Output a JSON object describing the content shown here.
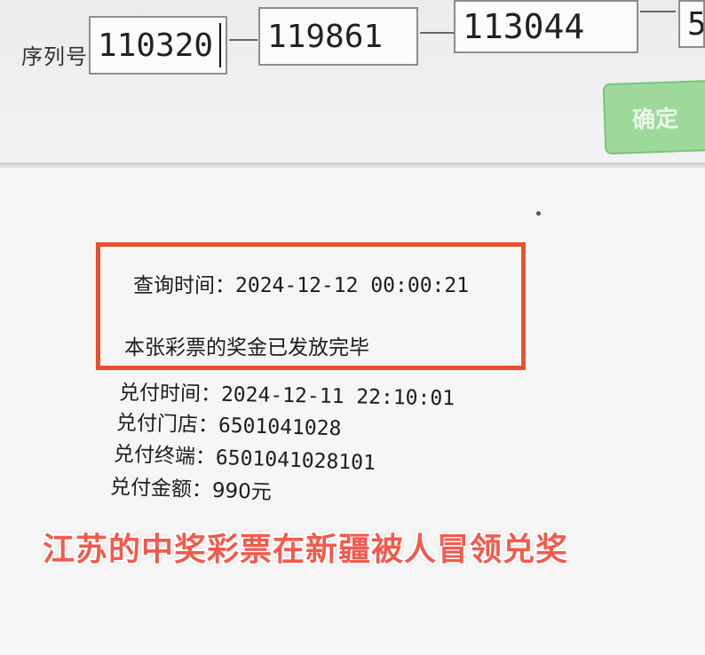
{
  "header": {
    "serial_label": "序列号",
    "serial_segments": [
      "110320",
      "119861",
      "113044",
      "5"
    ],
    "confirm_button": "确定"
  },
  "result": {
    "query_time_label": "查询时间：",
    "query_time_value": "2024-12-12 00:00:21",
    "status_message": "本张彩票的奖金已发放完毕",
    "redeem_time_label": "兑付时间：",
    "redeem_time_value": "2024-12-11 22:10:01",
    "redeem_store_label": "兑付门店：",
    "redeem_store_value": "6501041028",
    "redeem_terminal_label": "兑付终端：",
    "redeem_terminal_value": "6501041028101",
    "redeem_amount_label": "兑付金额：",
    "redeem_amount_value": "990元"
  },
  "caption": "江苏的中奖彩票在新疆被人冒领兑奖",
  "colors": {
    "highlight_border": "#e8502f",
    "caption_text": "#f25a4d",
    "confirm_button_bg": "#9ed99b"
  }
}
